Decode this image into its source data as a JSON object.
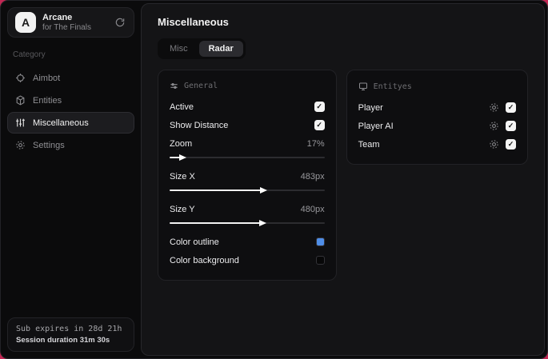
{
  "glyphs": {
    "check": "✓"
  },
  "app": {
    "name": "Arcane",
    "subtitle": "for The Finals"
  },
  "sidebar": {
    "category_label": "Category",
    "items": [
      {
        "label": "Aimbot"
      },
      {
        "label": "Entities"
      },
      {
        "label": "Miscellaneous"
      },
      {
        "label": "Settings"
      }
    ],
    "subscription": {
      "line1": "Sub expires in 28d 21h",
      "line2": "Session duration 31m 30s"
    }
  },
  "main": {
    "title": "Miscellaneous",
    "tabs": [
      {
        "label": "Misc"
      },
      {
        "label": "Radar"
      }
    ],
    "general": {
      "header": "General",
      "active": {
        "label": "Active",
        "checked": true
      },
      "show_distance": {
        "label": "Show Distance",
        "checked": true
      },
      "zoom": {
        "label": "Zoom",
        "value": "17%",
        "percent": 8.5
      },
      "size_x": {
        "label": "Size X",
        "value": "483px",
        "percent": 60.4
      },
      "size_y": {
        "label": "Size Y",
        "value": "480px",
        "percent": 60
      },
      "color_outline": {
        "label": "Color outline",
        "color": "#4f8ee8"
      },
      "color_background": {
        "label": "Color background",
        "color": "#070708"
      }
    },
    "entities": {
      "header": "Entityes",
      "rows": [
        {
          "label": "Player"
        },
        {
          "label": "Player AI"
        },
        {
          "label": "Team"
        }
      ]
    }
  }
}
